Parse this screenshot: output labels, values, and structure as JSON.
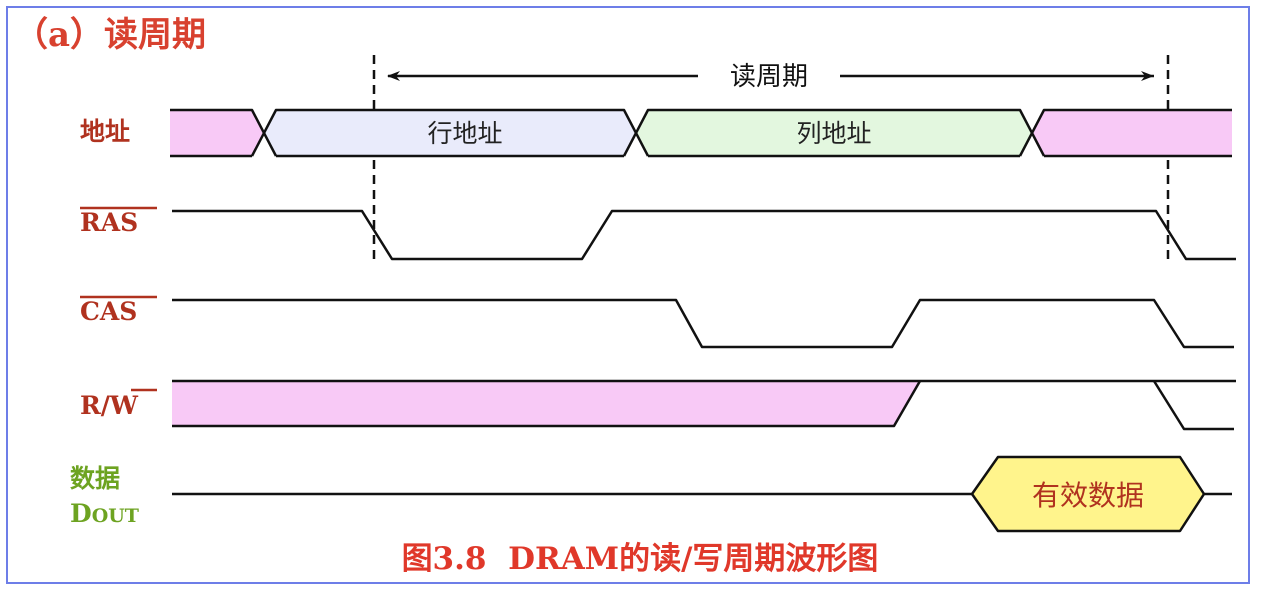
{
  "title": "（a）读周期",
  "read_cycle_label": "读周期",
  "signals": {
    "address": "地址",
    "ras": "RAS",
    "cas": "CAS",
    "rw_r": "R/",
    "rw_w": "W",
    "data_line1": "数据",
    "data_line2_main": "D",
    "data_line2_sub": "OUT"
  },
  "address_boxes": {
    "row": "行地址",
    "column": "列地址"
  },
  "valid_data": "有效数据",
  "caption": "图3.8  DRAM的读/写周期波形图",
  "colors": {
    "pink": "#f8c9f6",
    "lavender": "#e9ebfb",
    "mint": "#e3f7df",
    "valid_fill": "#fff48c"
  }
}
